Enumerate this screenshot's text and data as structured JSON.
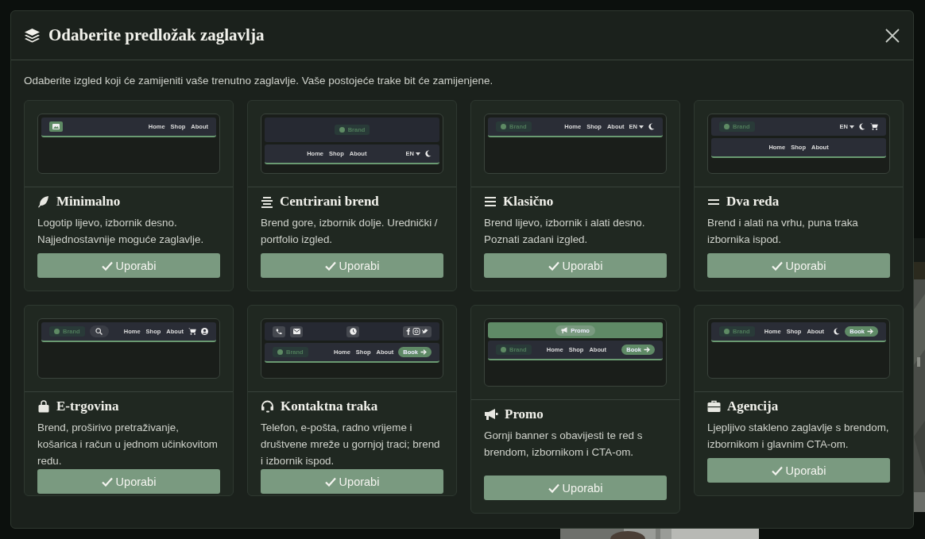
{
  "dialog": {
    "title": "Odaberite predložak zaglavlja",
    "description": "Odaberite izgled koji će zamijeniti vaše trenutno zaglavlje. Vaše postojeće trake bit će zamijenjene.",
    "templates": [
      {
        "title": "Minimalno",
        "description": "Logotip lijevo, izbornik desno. Najjednostavnije moguće zaglavlje.",
        "button": "Uporabi",
        "preview": [
          {
            "kind": "bar",
            "items": [
              {
                "kind": "logo"
              },
              {
                "kind": "spacer"
              },
              {
                "kind": "nav",
                "links": [
                  "Home",
                  "Shop",
                  "About"
                ]
              }
            ]
          }
        ]
      },
      {
        "title": "Centrirani brend",
        "description": "Brend gore, izbornik dolje. Urednički / portfolio izgled.",
        "button": "Uporabi",
        "preview": [
          {
            "kind": "top",
            "items": [
              {
                "kind": "spacer"
              },
              {
                "kind": "brand",
                "label": "Brand"
              },
              {
                "kind": "spacer"
              }
            ]
          },
          {
            "kind": "bar",
            "items": [
              {
                "kind": "spacer"
              },
              {
                "kind": "nav",
                "links": [
                  "Home",
                  "Shop",
                  "About"
                ]
              },
              {
                "kind": "spacer"
              },
              {
                "kind": "lang",
                "label": "EN"
              },
              {
                "kind": "moon"
              }
            ]
          }
        ]
      },
      {
        "title": "Klasično",
        "description": "Brend lijevo, izbornik i alati desno. Poznati zadani izgled.",
        "button": "Uporabi",
        "preview": [
          {
            "kind": "bar",
            "items": [
              {
                "kind": "brand",
                "label": "Brand"
              },
              {
                "kind": "spacer"
              },
              {
                "kind": "nav",
                "links": [
                  "Home",
                  "Shop",
                  "About"
                ]
              },
              {
                "kind": "lang",
                "label": "EN"
              },
              {
                "kind": "moon"
              }
            ]
          }
        ]
      },
      {
        "title": "Dva reda",
        "description": "Brend i alati na vrhu, puna traka izbornika ispod.",
        "button": "Uporabi",
        "preview": [
          {
            "kind": "plain",
            "items": [
              {
                "kind": "brand",
                "label": "Brand"
              },
              {
                "kind": "spacer"
              },
              {
                "kind": "lang",
                "label": "EN"
              },
              {
                "kind": "moon"
              },
              {
                "kind": "cart"
              }
            ]
          },
          {
            "kind": "bar",
            "items": [
              {
                "kind": "spacer"
              },
              {
                "kind": "nav",
                "links": [
                  "Home",
                  "Shop",
                  "About"
                ]
              },
              {
                "kind": "spacer"
              }
            ]
          }
        ]
      },
      {
        "title": "E-trgovina",
        "description": "Brend, proširivo pretraživanje, košarica i račun u jednom učinkovitom redu.",
        "button": "Uporabi",
        "preview": [
          {
            "kind": "bar",
            "items": [
              {
                "kind": "brand",
                "label": "Brand"
              },
              {
                "kind": "search"
              },
              {
                "kind": "spacer"
              },
              {
                "kind": "nav",
                "links": [
                  "Home",
                  "Shop",
                  "About"
                ]
              },
              {
                "kind": "cart"
              },
              {
                "kind": "user"
              }
            ]
          }
        ]
      },
      {
        "title": "Kontaktna traka",
        "description": "Telefon, e-pošta, radno vrijeme i društvene mreže u gornjoj traci; brend i izbornik ispod.",
        "button": "Uporabi",
        "preview": [
          {
            "kind": "top",
            "items": [
              {
                "kind": "phone"
              },
              {
                "kind": "mail"
              },
              {
                "kind": "spacer"
              },
              {
                "kind": "clock"
              },
              {
                "kind": "spacer"
              },
              {
                "kind": "social"
              }
            ]
          },
          {
            "kind": "bar",
            "items": [
              {
                "kind": "brand",
                "label": "Brand"
              },
              {
                "kind": "spacer"
              },
              {
                "kind": "nav",
                "links": [
                  "Home",
                  "Shop",
                  "About"
                ]
              },
              {
                "kind": "book",
                "label": "Book"
              }
            ]
          }
        ]
      },
      {
        "title": "Promo",
        "description": "Gornji banner s obavijesti te red s brendom, izbornikom i CTA-om.",
        "button": "Uporabi",
        "preview": [
          {
            "kind": "banner",
            "items": [
              {
                "kind": "spacer"
              },
              {
                "kind": "promo",
                "label": "Promo"
              },
              {
                "kind": "spacer"
              }
            ]
          },
          {
            "kind": "bar",
            "items": [
              {
                "kind": "brand",
                "label": "Brand"
              },
              {
                "kind": "spacer"
              },
              {
                "kind": "nav",
                "links": [
                  "Home",
                  "Shop",
                  "About"
                ]
              },
              {
                "kind": "spacer"
              },
              {
                "kind": "book",
                "label": "Book"
              }
            ]
          }
        ]
      },
      {
        "title": "Agencija",
        "description": "Ljepljivo stakleno zaglavlje s brendom, izbornikom i glavnim CTA-om.",
        "button": "Uporabi",
        "preview": [
          {
            "kind": "bar",
            "items": [
              {
                "kind": "brand",
                "label": "Brand"
              },
              {
                "kind": "spacer"
              },
              {
                "kind": "nav",
                "links": [
                  "Home",
                  "Shop",
                  "About"
                ]
              },
              {
                "kind": "spacer"
              },
              {
                "kind": "moon"
              },
              {
                "kind": "book",
                "label": "Book"
              }
            ]
          }
        ]
      }
    ]
  }
}
